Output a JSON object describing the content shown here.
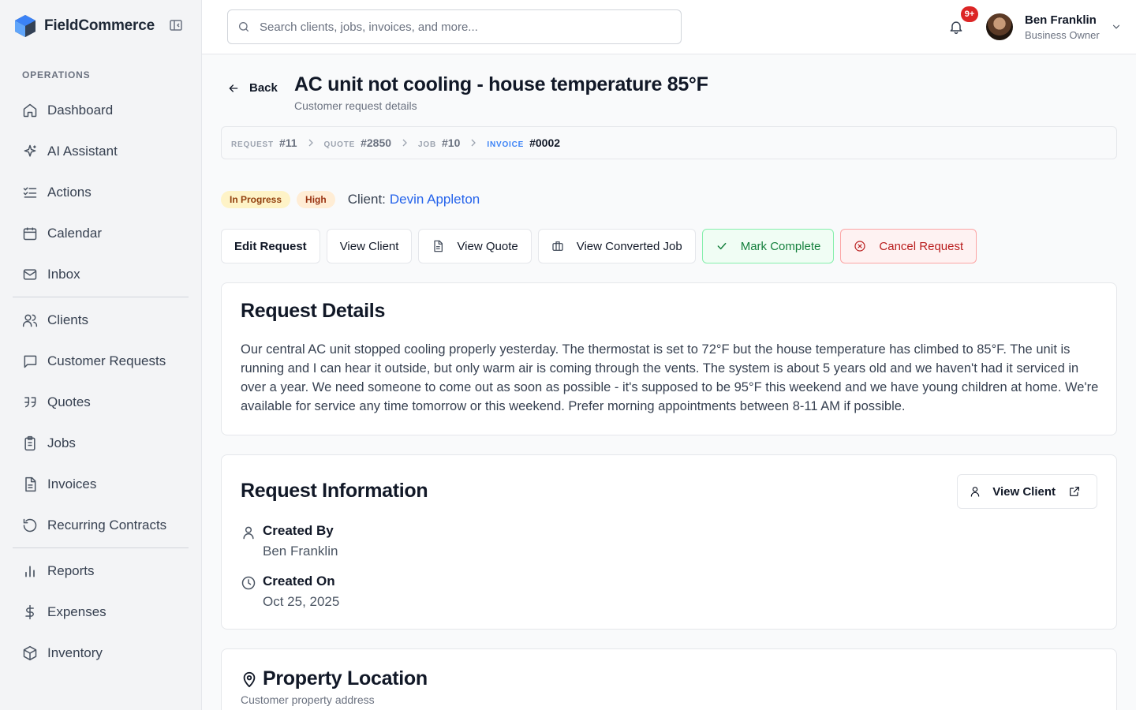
{
  "brand": {
    "name": "FieldCommerce"
  },
  "sidebar": {
    "section_label": "OPERATIONS",
    "groups": [
      [
        {
          "label": "Dashboard",
          "icon": "home-icon"
        },
        {
          "label": "AI Assistant",
          "icon": "sparkles-icon"
        },
        {
          "label": "Actions",
          "icon": "list-checks-icon"
        },
        {
          "label": "Calendar",
          "icon": "calendar-icon"
        },
        {
          "label": "Inbox",
          "icon": "mail-icon"
        }
      ],
      [
        {
          "label": "Clients",
          "icon": "users-icon"
        },
        {
          "label": "Customer Requests",
          "icon": "message-square-icon"
        },
        {
          "label": "Quotes",
          "icon": "quote-icon"
        },
        {
          "label": "Jobs",
          "icon": "clipboard-icon"
        },
        {
          "label": "Invoices",
          "icon": "file-text-icon"
        },
        {
          "label": "Recurring Contracts",
          "icon": "rotate-ccw-icon"
        }
      ],
      [
        {
          "label": "Reports",
          "icon": "bar-chart-icon"
        },
        {
          "label": "Expenses",
          "icon": "dollar-icon"
        },
        {
          "label": "Inventory",
          "icon": "box-icon"
        }
      ]
    ]
  },
  "header": {
    "search_placeholder": "Search clients, jobs, invoices, and more...",
    "notification_count": "9+",
    "user": {
      "name": "Ben Franklin",
      "role": "Business Owner"
    }
  },
  "page": {
    "back_label": "Back",
    "title": "AC unit not cooling - house temperature 85°F",
    "subtitle": "Customer request details",
    "breadcrumb": [
      {
        "key": "REQUEST",
        "value": "#11"
      },
      {
        "key": "QUOTE",
        "value": "#2850"
      },
      {
        "key": "JOB",
        "value": "#10"
      },
      {
        "key": "INVOICE",
        "value": "#0002"
      }
    ],
    "status": "In Progress",
    "priority": "High",
    "client_label": "Client:",
    "client_name": "Devin Appleton",
    "actions": {
      "edit": "Edit Request",
      "view_client": "View Client",
      "view_quote": "View Quote",
      "view_job": "View Converted Job",
      "complete": "Mark Complete",
      "cancel": "Cancel Request"
    }
  },
  "details": {
    "title": "Request Details",
    "body": "Our central AC unit stopped cooling properly yesterday. The thermostat is set to 72°F but the house temperature has climbed to 85°F. The unit is running and I can hear it outside, but only warm air is coming through the vents. The system is about 5 years old and we haven't had it serviced in over a year. We need someone to come out as soon as possible - it's supposed to be 95°F this weekend and we have young children at home. We're available for service any time tomorrow or this weekend. Prefer morning appointments between 8-11 AM if possible."
  },
  "info": {
    "title": "Request Information",
    "view_client_label": "View Client",
    "created_by_label": "Created By",
    "created_by": "Ben Franklin",
    "created_on_label": "Created On",
    "created_on": "Oct 25, 2025"
  },
  "location": {
    "title": "Property Location",
    "subtitle": "Customer property address"
  },
  "colors": {
    "accent": "#2563eb",
    "success": "#15803d",
    "danger": "#b91c1c",
    "badge_red": "#dc2626"
  }
}
